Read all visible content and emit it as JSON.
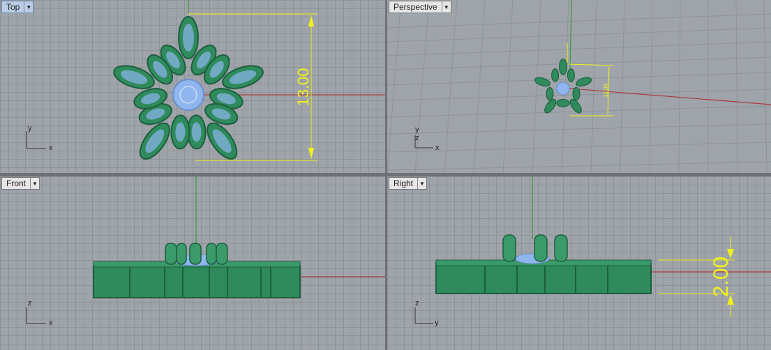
{
  "viewports": {
    "top": {
      "title": "Top",
      "axis_h": "x",
      "axis_v": "y",
      "dimension": "13.00"
    },
    "perspective": {
      "title": "Perspective",
      "axis_h": "x",
      "axis_v": "y",
      "axis_z": "z",
      "dimension": "13.00"
    },
    "front": {
      "title": "Front",
      "axis_h": "x",
      "axis_v": "z"
    },
    "right": {
      "title": "Right",
      "axis_h": "y",
      "axis_v": "z",
      "dimension": "2.00"
    }
  },
  "icons": {
    "dropdown": "chevron-down-icon"
  },
  "colors": {
    "model": "#2f8a5c",
    "gem": "#8fb6ee",
    "dimension": "#f2f21a",
    "x_axis": "#a83a3a",
    "y_axis": "#3a9a3a"
  }
}
